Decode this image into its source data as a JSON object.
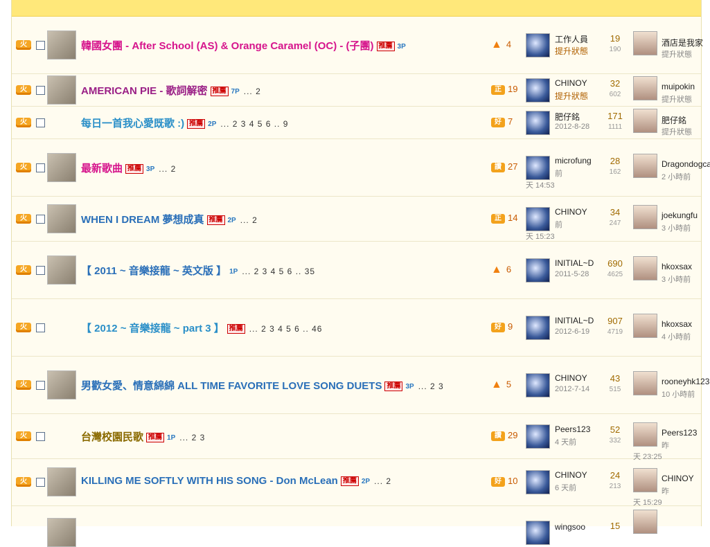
{
  "rows": [
    {
      "title": "韓國女團 - After School (AS) & Orange Caramel (OC) - (子團)",
      "color": "#d6148c",
      "tag": "推薦",
      "pg": "3P",
      "pages": "",
      "rating_icon": "arrow",
      "rating": "4",
      "poster": "工作人員",
      "poster_sub": "提升狀態",
      "replies": "19",
      "views": "190",
      "last": "酒店是我家",
      "last_sub": "提升狀態"
    },
    {
      "title": "AMERICAN PIE - 歌詞解密",
      "color": "#9a1f86",
      "tag": "推薦",
      "pg": "7P",
      "pages": "... 2",
      "rating_icon": "正",
      "rating": "19",
      "poster": "CHINOY",
      "poster_sub": "提升狀態",
      "replies": "32",
      "views": "602",
      "last": "muipokin",
      "last_sub": "提升狀態"
    },
    {
      "title": "每日一首我心愛既歌 :)",
      "color": "#2a8fc8",
      "tag": "推薦",
      "pg": "2P",
      "pages": "... 2 3 4 5 6 .. 9",
      "rating_icon": "好",
      "rating": "7",
      "poster": "肥仔銘",
      "poster_sub": "2012-8-28",
      "replies": "171",
      "views": "1111",
      "last": "肥仔銘",
      "last_sub": "提升狀態"
    },
    {
      "title": "最新歌曲",
      "color": "#d6148c",
      "tag": "推薦",
      "pg": "3P",
      "pages": "... 2",
      "rating_icon": "讚",
      "rating": "27",
      "poster": "microfung",
      "poster_sub": "前",
      "poster_sub2": "天 14:53",
      "replies": "28",
      "views": "162",
      "last": "Dragondogcat",
      "last_sub": "2 小時前"
    },
    {
      "title": "WHEN I DREAM 夢想成真",
      "color": "#2a6fb8",
      "tag": "推薦",
      "pg": "2P",
      "pages": "... 2",
      "rating_icon": "正",
      "rating": "14",
      "poster": "CHINOY",
      "poster_sub": "前",
      "poster_sub2": "天 15:23",
      "replies": "34",
      "views": "247",
      "last": "joekungfu",
      "last_sub": "3 小時前"
    },
    {
      "title": "【 2011 ~ 音樂接龍 ~ 英文版 】",
      "color": "#2a6fb8",
      "tag": "",
      "pg": "1P",
      "pages": "... 2 3 4 5 6 .. 35",
      "rating_icon": "arrow",
      "rating": "6",
      "poster": "INITIAL~D",
      "poster_sub": "2011-5-28",
      "replies": "690",
      "views": "4625",
      "last": "hkoxsax",
      "last_sub": "3 小時前"
    },
    {
      "title": "【 2012 ~ 音樂接龍 ~ part 3 】",
      "color": "#2a8fc8",
      "tag": "推薦",
      "pg": "",
      "pages": "... 2 3 4 5 6 .. 46",
      "rating_icon": "好",
      "rating": "9",
      "poster": "INITIAL~D",
      "poster_sub": "2012-6-19",
      "replies": "907",
      "views": "4719",
      "last": "hkoxsax",
      "last_sub": "4 小時前"
    },
    {
      "title": "男歡女愛、情意綿綿 ALL TIME FAVORITE LOVE SONG DUETS",
      "color": "#2a6fb8",
      "tag": "推薦",
      "pg": "3P",
      "pages": "... 2 3",
      "rating_icon": "arrow",
      "rating": "5",
      "poster": "CHINOY",
      "poster_sub": "2012-7-14",
      "replies": "43",
      "views": "515",
      "last": "rooneyhk123",
      "last_sub": "10 小時前"
    },
    {
      "title": "台灣校園民歌",
      "color": "#8a6a00",
      "tag": "推薦",
      "pg": "1P",
      "pages": "... 2 3",
      "rating_icon": "讚",
      "rating": "29",
      "poster": "Peers123",
      "poster_sub": "4 天前",
      "replies": "52",
      "views": "332",
      "last": "Peers123",
      "last_sub": "昨",
      "last_sub2": "天 23:25"
    },
    {
      "title": "KILLING ME SOFTLY WITH HIS SONG - Don McLean",
      "color": "#2a6fb8",
      "tag": "推薦",
      "pg": "2P",
      "pages": "... 2",
      "rating_icon": "好",
      "rating": "10",
      "poster": "CHINOY",
      "poster_sub": "6 天前",
      "replies": "24",
      "views": "213",
      "last": "CHINOY",
      "last_sub": "昨",
      "last_sub2": "天 15:29"
    }
  ],
  "partial": {
    "poster": "wingsoo",
    "replies": "15"
  },
  "hot_label": "火"
}
